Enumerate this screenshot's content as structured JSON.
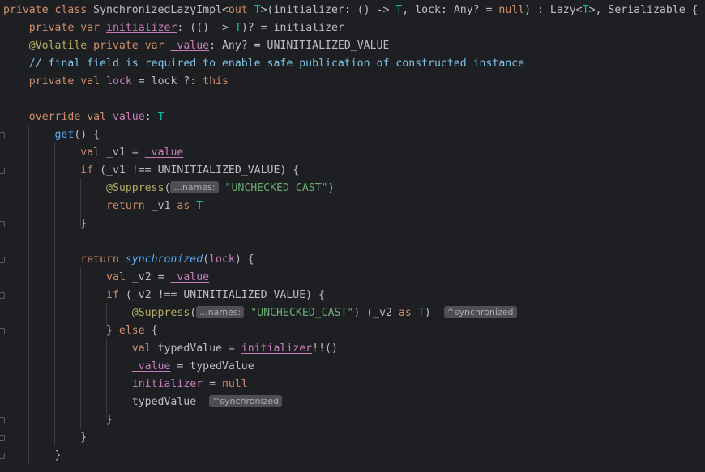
{
  "code_lines": [
    [
      [
        "kw",
        "private class "
      ],
      [
        "plain",
        "SynchronizedLazyImpl<"
      ],
      [
        "kw",
        "out "
      ],
      [
        "tp",
        "T"
      ],
      [
        "plain",
        ">(initializer: () -> "
      ],
      [
        "tp",
        "T"
      ],
      [
        "plain",
        ", lock: Any? = "
      ],
      [
        "kw",
        "null"
      ],
      [
        "plain",
        ") : Lazy<"
      ],
      [
        "tp",
        "T"
      ],
      [
        "plain",
        ">, Serializable {"
      ]
    ],
    [
      [
        "plain",
        "    "
      ],
      [
        "kw",
        "private var "
      ],
      [
        "fldu",
        "initializer"
      ],
      [
        "plain",
        ": (() -> "
      ],
      [
        "tp",
        "T"
      ],
      [
        "plain",
        ")? = initializer"
      ]
    ],
    [
      [
        "plain",
        "    "
      ],
      [
        "ann",
        "@Volatile "
      ],
      [
        "kw",
        "private var "
      ],
      [
        "fldu",
        "_value"
      ],
      [
        "plain",
        ": Any? = UNINITIALIZED_VALUE"
      ]
    ],
    [
      [
        "plain",
        "    "
      ],
      [
        "cmt",
        "// final field is required to enable safe publication of constructed instance"
      ]
    ],
    [
      [
        "plain",
        "    "
      ],
      [
        "kw",
        "private val "
      ],
      [
        "fld",
        "lock"
      ],
      [
        "plain",
        " = lock ?: "
      ],
      [
        "kw",
        "this"
      ]
    ],
    [],
    [
      [
        "plain",
        "    "
      ],
      [
        "kw",
        "override val "
      ],
      [
        "fld",
        "value"
      ],
      [
        "plain",
        ": "
      ],
      [
        "tp",
        "T"
      ]
    ],
    [
      [
        "plain",
        "        "
      ],
      [
        "fn",
        "get"
      ],
      [
        "plain",
        "() {"
      ]
    ],
    [
      [
        "plain",
        "            "
      ],
      [
        "kw",
        "val "
      ],
      [
        "plain",
        "_v1 = "
      ],
      [
        "fldu",
        "_value"
      ]
    ],
    [
      [
        "plain",
        "            "
      ],
      [
        "kw",
        "if "
      ],
      [
        "plain",
        "(_v1 !== UNINITIALIZED_VALUE) {"
      ]
    ],
    [
      [
        "plain",
        "                "
      ],
      [
        "ann",
        "@Suppress"
      ],
      [
        "plain",
        "("
      ],
      [
        "hint",
        "...names:"
      ],
      [
        "plain",
        " "
      ],
      [
        "str",
        "\"UNCHECKED_CAST\""
      ],
      [
        "plain",
        ")"
      ]
    ],
    [
      [
        "plain",
        "                "
      ],
      [
        "kw",
        "return "
      ],
      [
        "plain",
        "_v1 "
      ],
      [
        "kw",
        "as "
      ],
      [
        "tp",
        "T"
      ]
    ],
    [
      [
        "plain",
        "            }"
      ]
    ],
    [],
    [
      [
        "plain",
        "            "
      ],
      [
        "kw",
        "return "
      ],
      [
        "fn it",
        "synchronized"
      ],
      [
        "plain",
        "("
      ],
      [
        "fld",
        "lock"
      ],
      [
        "plain",
        ") {"
      ]
    ],
    [
      [
        "plain",
        "                "
      ],
      [
        "kw",
        "val "
      ],
      [
        "plain",
        "_v2 = "
      ],
      [
        "fldu",
        "_value"
      ]
    ],
    [
      [
        "plain",
        "                "
      ],
      [
        "kw",
        "if "
      ],
      [
        "plain",
        "(_v2 !== UNINITIALIZED_VALUE) {"
      ]
    ],
    [
      [
        "plain",
        "                    "
      ],
      [
        "ann",
        "@Suppress"
      ],
      [
        "plain",
        "("
      ],
      [
        "hint",
        "...names:"
      ],
      [
        "plain",
        " "
      ],
      [
        "str",
        "\"UNCHECKED_CAST\""
      ],
      [
        "plain",
        ") (_v2 "
      ],
      [
        "kw",
        "as "
      ],
      [
        "tp",
        "T"
      ],
      [
        "plain",
        ")  "
      ],
      [
        "hint",
        "^synchronized"
      ]
    ],
    [
      [
        "plain",
        "                } "
      ],
      [
        "kw",
        "else "
      ],
      [
        "plain",
        "{"
      ]
    ],
    [
      [
        "plain",
        "                    "
      ],
      [
        "kw",
        "val "
      ],
      [
        "plain",
        "typedValue = "
      ],
      [
        "fldu",
        "initializer"
      ],
      [
        "plain",
        "!!()"
      ]
    ],
    [
      [
        "plain",
        "                    "
      ],
      [
        "fldu",
        "_value"
      ],
      [
        "plain",
        " = typedValue"
      ]
    ],
    [
      [
        "plain",
        "                    "
      ],
      [
        "fldu",
        "initializer"
      ],
      [
        "plain",
        " = "
      ],
      [
        "kw",
        "null"
      ]
    ],
    [
      [
        "plain",
        "                    typedValue  "
      ],
      [
        "hint",
        "^synchronized"
      ]
    ],
    [
      [
        "plain",
        "                }"
      ]
    ],
    [
      [
        "plain",
        "            }"
      ]
    ],
    [
      [
        "plain",
        "        }"
      ]
    ]
  ],
  "colors": {
    "background": "#1e1f22",
    "keyword": "#cf8e6d",
    "field": "#c77dbb",
    "type_param": "#16baac",
    "annotation": "#b3ae60",
    "string": "#6aab73",
    "comment": "#7ec3e6",
    "function": "#56a8f5",
    "hint_bg": "#4d4f53"
  }
}
